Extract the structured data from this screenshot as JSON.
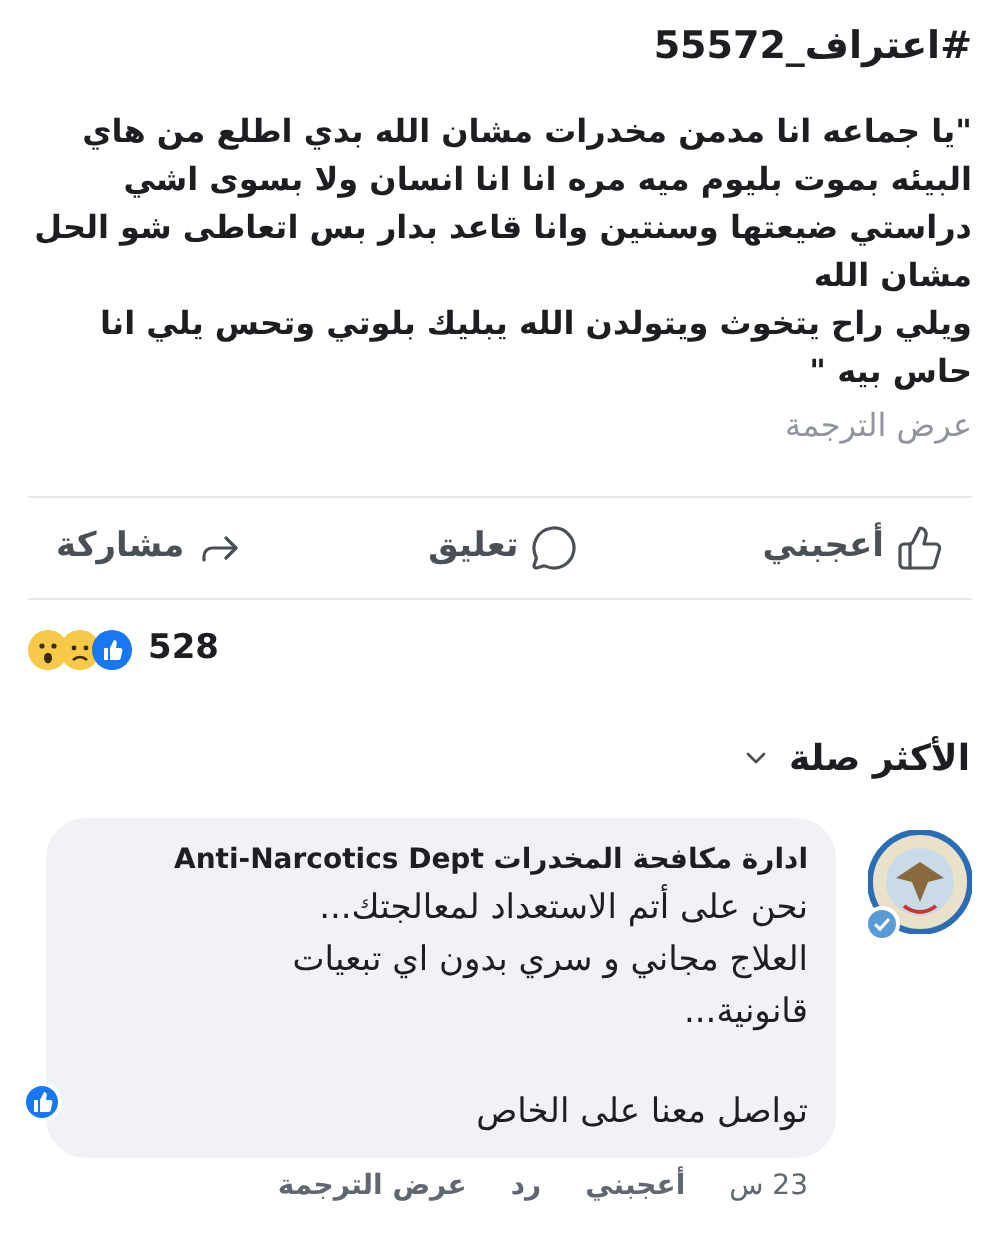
{
  "post": {
    "title": "#اعتراف_55572",
    "lines": [
      "\"يا جماعه انا مدمن مخدرات مشان الله بدي اطلع من هاي",
      "البيئه بموت بليوم ميه مره انا انا انسان ولا بسوى اشي",
      "دراستي ضيعتها وسنتين وانا قاعد بدار بس اتعاطى شو الحل",
      "مشان الله",
      "ويلي راح يتخوث ويتولدن الله يبليك بلوتي وتحس يلي انا",
      "حاس بيه \""
    ],
    "translate": "عرض الترجمة"
  },
  "actions": [
    {
      "kind": "like",
      "label": "أعجبني"
    },
    {
      "kind": "comment",
      "label": "تعليق"
    },
    {
      "kind": "share",
      "label": "مشاركة"
    }
  ],
  "reactions": {
    "count": "528"
  },
  "sort": {
    "label": "الأكثر صلة"
  },
  "comment": {
    "author": "ادارة مكافحة المخدرات Anti-Narcotics Dept",
    "lines": [
      "نحن على أتم الاستعداد لمعالجتك...",
      "العلاج مجاني و سري بدون اي تبعيات",
      "قانونية..."
    ],
    "closing": "تواصل معنا على الخاص",
    "footer": [
      {
        "kind": "time",
        "label": "23 س"
      },
      {
        "kind": "like",
        "label": "أعجبني"
      },
      {
        "kind": "reply",
        "label": "رد"
      },
      {
        "kind": "translate",
        "label": "عرض الترجمة"
      }
    ]
  }
}
